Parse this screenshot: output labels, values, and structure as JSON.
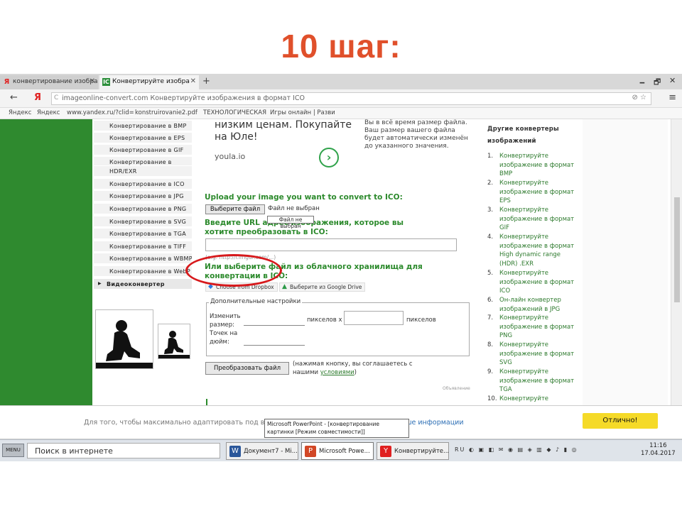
{
  "slide_title": "10 шаг:",
  "browser": {
    "tabs": [
      {
        "label": "конвертирование изобра",
        "favicon": "Я"
      },
      {
        "label": "Конвертируйте изобра",
        "favicon": "IC"
      }
    ],
    "new_tab": "+",
    "window_controls": {
      "min": "🗕",
      "max": "🗗",
      "close": "✕"
    },
    "nav": {
      "back": "←",
      "yandex": "Я",
      "reload": "C"
    },
    "url": "imageonline-convert.com  Конвертируйте изображения в формат ICO",
    "url_right": "⊘  ☆",
    "menu": "≡",
    "bookmarks": [
      "Яндекс",
      "Яндекс",
      "www.yandex.ru/?clid=",
      "konstruirovanie2.pdf",
      "ТЕХНОЛОГИЧЕСКАЯ",
      "Игры онлайн | Разви"
    ]
  },
  "left_nav": {
    "items": [
      "Конвертирование в BMP",
      "Конвертирование в EPS",
      "Конвертирование в GIF",
      "Конвертирование в",
      "HDR/EXR",
      "Конвертирование в ICO",
      "Конвертирование в JPG",
      "Конвертирование в PNG",
      "Конвертирование в SVG",
      "Конвертирование в TGA",
      "Конвертирование в TIFF",
      "Конвертирование в WBMP",
      "Конвертирование в WebP"
    ],
    "video": "Видеоконвертер"
  },
  "ad": {
    "text_line1": "низким ценам. Покупайте",
    "text_line2": "на Юле!",
    "source": "youla.io",
    "arrow": "›",
    "right_text": "Вы в всё время размер файла. Ваш размер вашего файла будет автоматически изменён до указанного значения."
  },
  "form": {
    "upload_label": "Upload your image you want to convert to ICO:",
    "file_button": "Выберите файл",
    "no_file": "Файл не выбран",
    "tooltip": "Файл не выбран",
    "url_heading": "Введите URL адрес изображения, которое вы хотите преобразовать в ICO:",
    "url_hint": "(e.g. http://i.imgur.com/...)",
    "cloud_heading": "Или выберите файл из облачного хранилища для конвертации в ICO:",
    "dropbox": "Choose from Dropbox",
    "gdrive": "Выберите из Google Drive",
    "settings_legend": "Дополнительные настройки",
    "resize_label": "Изменить размер:",
    "pixels_x": "пикселов x",
    "pixels": "пикселов",
    "dpi_label": "Точек на дюйм:",
    "convert_button": "Преобразовать файл",
    "convert_note": "(нажимая кнопку, вы соглашаетесь с нашими",
    "convert_note_link": "условиями",
    "convert_note_end": ")",
    "ad_tag": "Объявление"
  },
  "right_sidebar": {
    "heading": "Другие конвертеры изображений",
    "items": [
      "Конвертируйте изображение в формат BMP",
      "Конвертируйте изображение в формат EPS",
      "Конвертируйте изображение в формат GIF",
      "Конвертируйте изображение в формат High dynamic range (HDR) .EXR",
      "Конвертируйте изображение в формат ICO",
      "Он-лайн конвертер изображений в JPG",
      "Конвертируйте изображение в формат PNG",
      "Конвертируйте изображение в формат SVG",
      "Конвертируйте изображение в формат TGA",
      "Конвертируйте"
    ]
  },
  "notification": {
    "text": "Для того, чтобы максимально адаптировать под вас свой сайт, мы используем куки",
    "link": "Больше информации",
    "button": "Отлично!"
  },
  "powerpoint_tooltip": "Microsoft PowerPoint - [конвертирование картинки [Режим совместимости]]",
  "taskbar": {
    "start": "MENU",
    "search": "Поиск в интернете",
    "tasks": [
      {
        "label": "Документ7 - Mi...",
        "icon": "W",
        "color": "#2b579a"
      },
      {
        "label": "Microsoft Powe...",
        "icon": "P",
        "color": "#d24726"
      },
      {
        "label": "Конвертируйте...",
        "icon": "Y",
        "color": "#e02020"
      }
    ],
    "lang": "RU",
    "time": "11:16",
    "date": "17.04.2017"
  }
}
